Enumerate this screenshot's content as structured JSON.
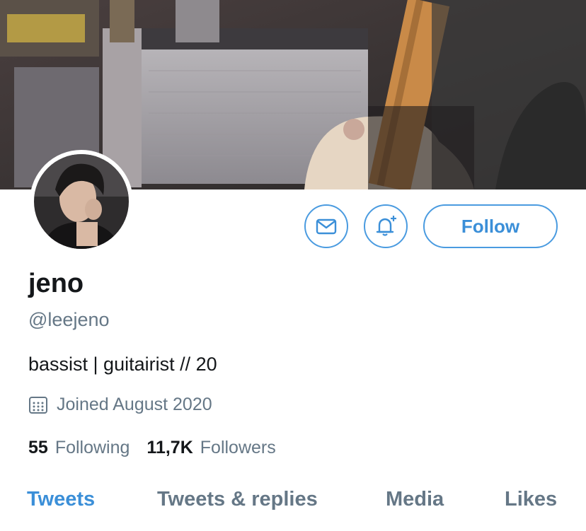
{
  "banner": {
    "image": "guitars-and-amp-photo"
  },
  "profile": {
    "avatar": "profile-photo",
    "name": "jeno",
    "handle": "@leejeno",
    "bio": "bassist | guitairist // 20",
    "joined": "Joined August 2020",
    "following_count": "55",
    "following_label": "Following",
    "followers_count": "11,7K",
    "followers_label": "Followers"
  },
  "actions": {
    "message_icon": "envelope-icon",
    "notify_icon": "bell-plus-icon",
    "follow_label": "Follow"
  },
  "tabs": [
    {
      "label": "Tweets",
      "active": true
    },
    {
      "label": "Tweets & replies",
      "active": false
    },
    {
      "label": "Media",
      "active": false
    },
    {
      "label": "Likes",
      "active": false
    }
  ],
  "colors": {
    "accent": "#3b8fd8",
    "secondary_text": "#657786",
    "primary_text": "#14171a"
  }
}
